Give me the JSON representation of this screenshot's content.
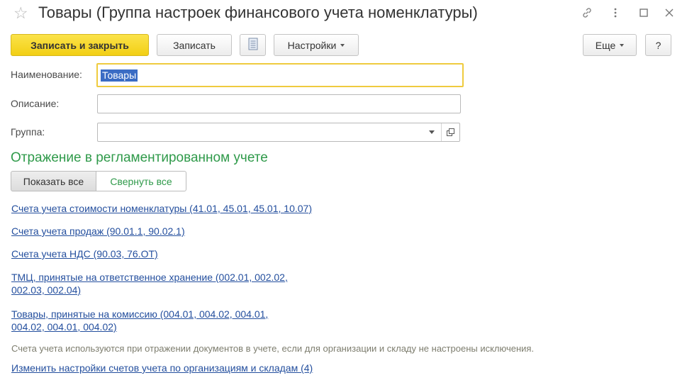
{
  "window": {
    "title": "Товары (Группа настроек финансового учета номенклатуры)"
  },
  "toolbar": {
    "save_close_label": "Записать и закрыть",
    "save_label": "Записать",
    "settings_label": "Настройки",
    "more_label": "Еще",
    "help_label": "?"
  },
  "form": {
    "name_label": "Наименование:",
    "name_value": "Товары",
    "description_label": "Описание:",
    "description_value": "",
    "group_label": "Группа:",
    "group_value": ""
  },
  "section": {
    "title": "Отражение в регламентированном учете",
    "show_all_label": "Показать все",
    "collapse_all_label": "Свернуть все"
  },
  "links": [
    "Счета учета стоимости номенклатуры (41.01, 45.01, 45.01, 10.07)",
    "Счета учета продаж (90.01.1, 90.02.1)",
    "Счета учета НДС (90.03, 76.ОТ)",
    "ТМЦ, принятые на ответственное хранение (002.01, 002.02,",
    "002.03, 002.04)",
    "Товары, принятые на комиссию (004.01, 004.02, 004.01,",
    "004.02, 004.01, 004.02)"
  ],
  "note": "Счета учета используются при отражении документов в учете, если для организации и складу не настроены исключения.",
  "change_link": "Изменить настройки счетов учета по организациям и складам (4)",
  "colors": {
    "accent_green": "#2f9a4a",
    "link_blue": "#244f9e",
    "primary_yellow": "#f2cf14"
  }
}
